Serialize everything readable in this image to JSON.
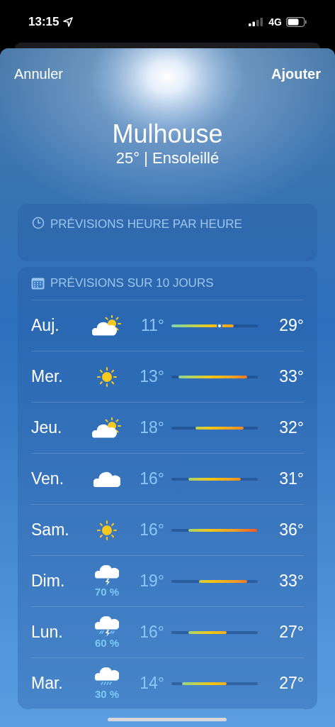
{
  "status_bar": {
    "time": "13:15",
    "network": "4G"
  },
  "header": {
    "cancel": "Annuler",
    "add": "Ajouter"
  },
  "location": {
    "city": "Mulhouse",
    "subtitle": "25° | Ensoleillé"
  },
  "hourly_forecast": {
    "title": "PRÉVISIONS HEURE PAR HEURE"
  },
  "daily_forecast": {
    "title": "PRÉVISIONS SUR 10 JOURS",
    "days": [
      {
        "day": "Auj.",
        "kind": "partly_sunny",
        "low": "11°",
        "high": "29°",
        "current_marker": true
      },
      {
        "day": "Mer.",
        "kind": "sunny",
        "low": "13°",
        "high": "33°",
        "current_marker": false
      },
      {
        "day": "Jeu.",
        "kind": "partly_sunny",
        "low": "18°",
        "high": "32°",
        "current_marker": false
      },
      {
        "day": "Ven.",
        "kind": "cloudy",
        "low": "16°",
        "high": "31°",
        "current_marker": false
      },
      {
        "day": "Sam.",
        "kind": "sunny",
        "low": "16°",
        "high": "36°",
        "current_marker": false
      },
      {
        "day": "Dim.",
        "kind": "thunderstorm",
        "precipitation": "70 %",
        "low": "19°",
        "high": "33°",
        "current_marker": false
      },
      {
        "day": "Lun.",
        "kind": "storm_rain",
        "precipitation": "60 %",
        "low": "16°",
        "high": "27°",
        "current_marker": false
      },
      {
        "day": "Mar.",
        "kind": "rain",
        "precipitation": "30 %",
        "low": "14°",
        "high": "27°",
        "current_marker": false
      }
    ]
  }
}
